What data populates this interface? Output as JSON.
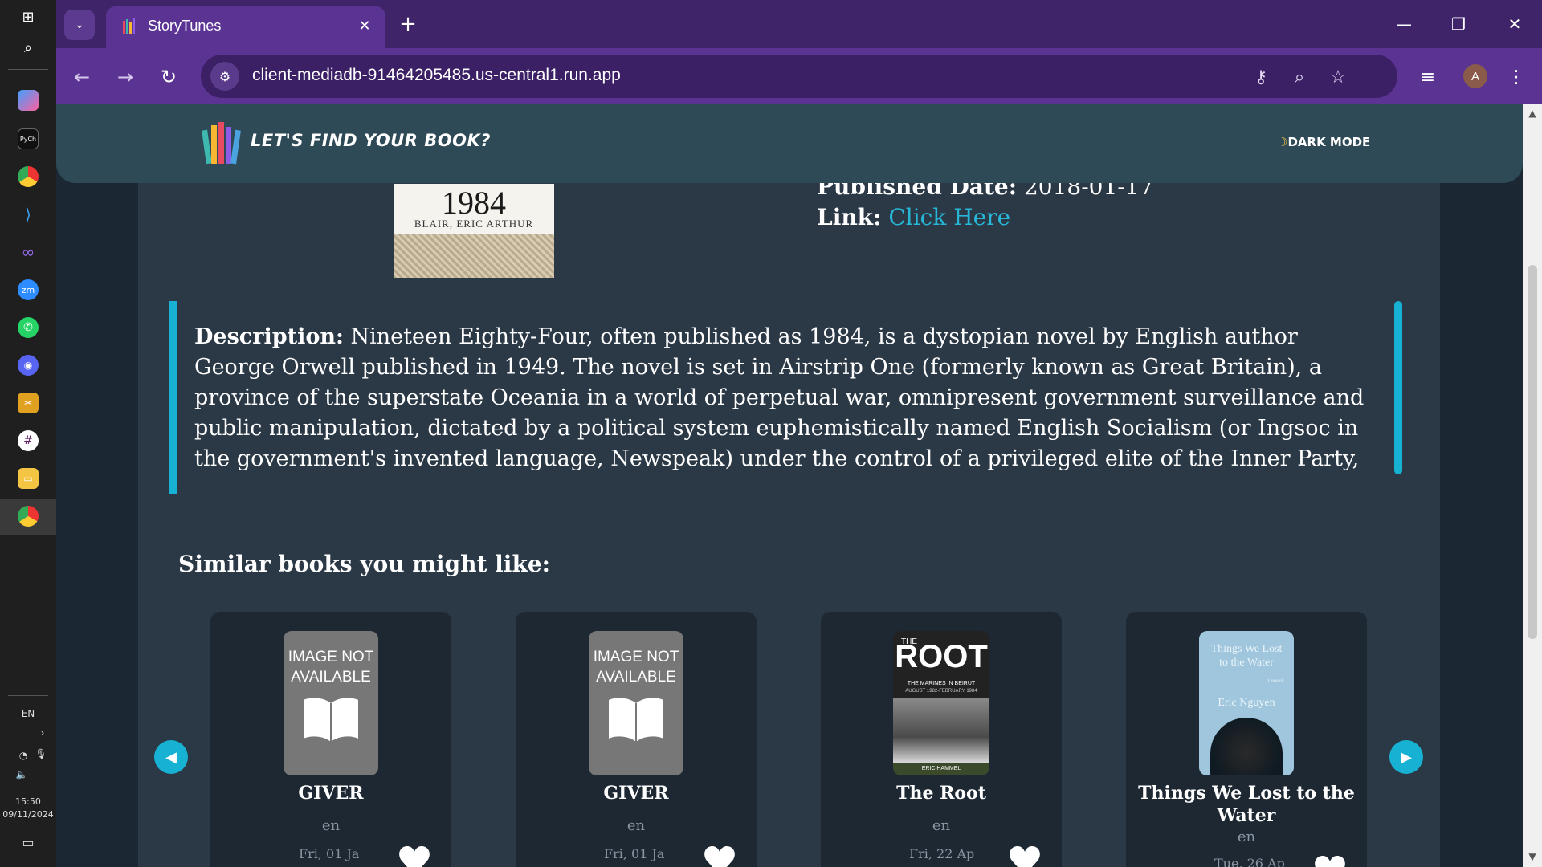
{
  "taskbar": {
    "language": "EN",
    "time": "15:50",
    "date": "09/11/2024"
  },
  "browser": {
    "tab_title": "StoryTunes",
    "url": "client-mediadb-91464205485.us-central1.run.app",
    "avatar_letter": "A",
    "accent_color": "#5b3393"
  },
  "header": {
    "site_title": "LET'S FIND YOUR BOOK?",
    "dark_mode_label": "DARK MODE"
  },
  "book": {
    "cover_title": "1984",
    "cover_author": "BLAIR, ERIC ARTHUR",
    "published_label": "Published Date:",
    "published_value": "2018-01-17",
    "link_label": "Link:",
    "link_text": "Click Here",
    "description_label": "Description:",
    "description_text": "Nineteen Eighty-Four, often published as 1984, is a dystopian novel by English author George Orwell published in 1949. The novel is set in Airstrip One (formerly known as Great Britain), a province of the superstate Oceania in a world of perpetual war, omnipresent government surveillance and public manipulation, dictated by a political system euphemistically named English Socialism (or Ingsoc in the government's invented language, Newspeak) under the control of a privileged elite of the Inner Party, that persecutes individualism and independent thinking as \"thoughtcrime"
  },
  "similar": {
    "heading": "Similar books you might like:",
    "books": [
      {
        "title": "GIVER",
        "lang": "en",
        "date": "Fri, 01 Ja",
        "image": "IMAGE NOT AVAILABLE"
      },
      {
        "title": "GIVER",
        "lang": "en",
        "date": "Fri, 01 Ja",
        "image": "IMAGE NOT AVAILABLE"
      },
      {
        "title": "The Root",
        "lang": "en",
        "date": "Fri, 22 Ap",
        "cover_top": "THE",
        "cover_title": "ROOT",
        "cover_sub": "THE MARINES IN BEIRUT",
        "cover_dates": "AUGUST 1982-FEBRUARY 1984",
        "cover_author": "ERIC HAMMEL"
      },
      {
        "title": "Things We Lost to the Water",
        "lang": "en",
        "date": "Tue, 26 Ap",
        "cover_title": "Things We Lost to the Water",
        "cover_author": "Eric Nguyen",
        "cover_mark": "a novel"
      }
    ]
  },
  "colors": {
    "accent": "#17b1d3",
    "panel": "#2b3846",
    "header": "#2e4a57"
  }
}
